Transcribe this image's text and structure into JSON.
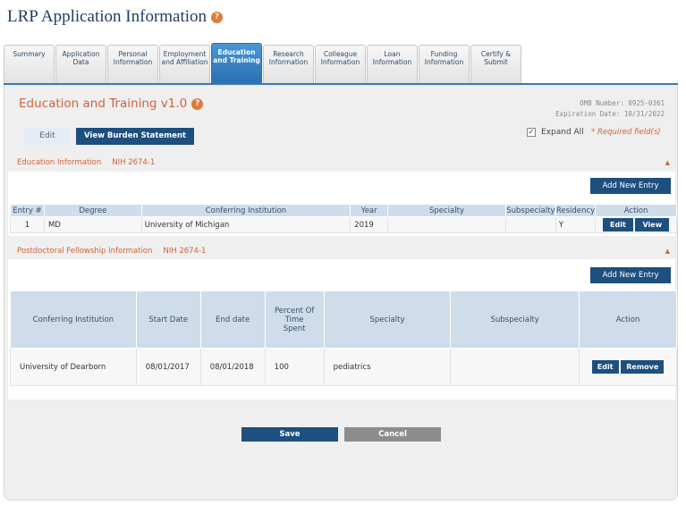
{
  "page": {
    "title": "LRP Application Information",
    "help": "?"
  },
  "tabs": [
    {
      "label": "Summary"
    },
    {
      "label": "Application Data"
    },
    {
      "label": "Personal Information"
    },
    {
      "label": "Employment and Affiliation"
    },
    {
      "label": "Education and Training"
    },
    {
      "label": "Research Information"
    },
    {
      "label": "Colleague Information"
    },
    {
      "label": "Loan Information"
    },
    {
      "label": "Funding Information"
    },
    {
      "label": "Certify & Submit"
    }
  ],
  "section": {
    "title": "Education and Training v1.0",
    "omb_number": "OMB Number: 0925-0361",
    "expiration": "Expiration Date: 10/31/2022",
    "edit_label": "Edit",
    "burden_label": "View Burden Statement",
    "expand_label": "Expand All",
    "expand_checked": "✓",
    "required_label": "* Required field(s)"
  },
  "education": {
    "heading": "Education Information",
    "form_no": "NIH 2674-1",
    "add_label": "Add New Entry",
    "columns": [
      "Entry #",
      "Degree",
      "Conferring Institution",
      "Year",
      "Specialty",
      "Subspecialty",
      "Residency",
      "Action"
    ],
    "rows": [
      {
        "entry": "1",
        "degree": "MD",
        "institution": "University of Michigan",
        "year": "2019",
        "specialty": "",
        "subspecialty": "",
        "residency": "Y",
        "edit": "Edit",
        "view": "View"
      }
    ]
  },
  "postdoc": {
    "heading": "Postdoctoral Fellowship Information",
    "form_no": "NIH 2674-1",
    "add_label": "Add New Entry",
    "columns": [
      "Conferring Institution",
      "Start Date",
      "End date",
      "Percent Of Time Spent",
      "Specialty",
      "Subspecialty",
      "Action"
    ],
    "rows": [
      {
        "institution": "University of Dearborn",
        "start": "08/01/2017",
        "end": "08/01/2018",
        "percent": "100",
        "specialty": "pediatrics",
        "subspecialty": "",
        "edit": "Edit",
        "remove": "Remove"
      }
    ]
  },
  "footer": {
    "save_label": "Save",
    "cancel_label": "Cancel"
  },
  "colors": {
    "accent": "#1d4f7f",
    "tab_active": "#2a6fb0",
    "heading": "#d0623a"
  }
}
